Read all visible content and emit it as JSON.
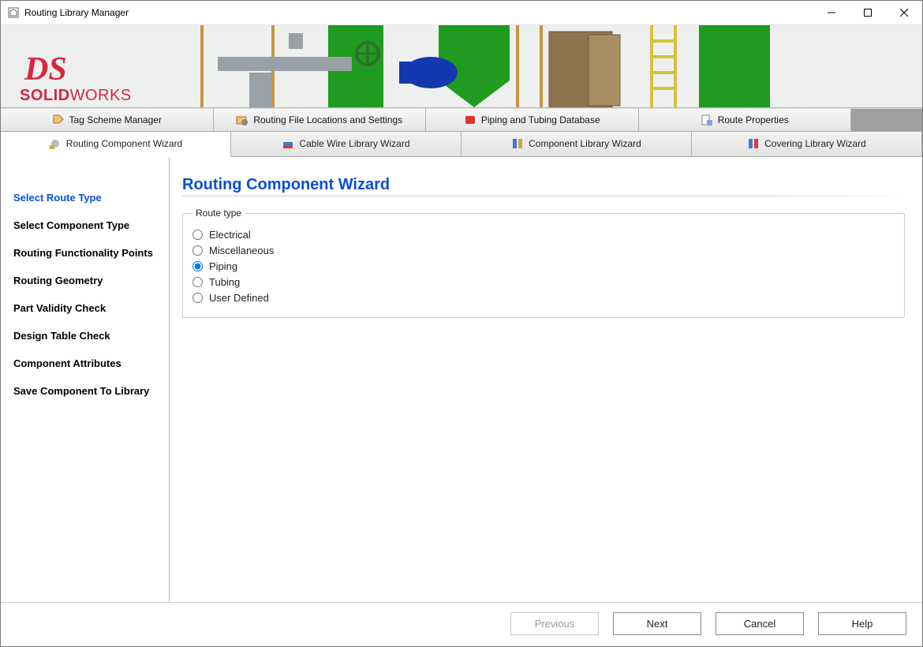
{
  "window": {
    "title": "Routing Library Manager"
  },
  "logo": {
    "ds": "DS",
    "brand_bold": "SOLID",
    "brand_thin": "WORKS"
  },
  "toolbar_tabs": {
    "tag_scheme": "Tag Scheme Manager",
    "file_loc": "Routing File Locations and Settings",
    "piping_db": "Piping and Tubing Database",
    "route_props": "Route Properties"
  },
  "wizard_tabs": {
    "component": "Routing Component Wizard",
    "cable": "Cable Wire Library Wizard",
    "complib": "Component Library Wizard",
    "covering": "Covering Library Wizard"
  },
  "sidebar_steps": [
    "Select Route Type",
    "Select Component Type",
    "Routing Functionality Points",
    "Routing Geometry",
    "Part Validity Check",
    "Design Table Check",
    "Component Attributes",
    "Save Component To Library"
  ],
  "main": {
    "heading": "Routing Component Wizard",
    "group_label": "Route type",
    "options": {
      "electrical": "Electrical",
      "misc": "Miscellaneous",
      "piping": "Piping",
      "tubing": "Tubing",
      "userdefined": "User Defined"
    },
    "selected": "piping"
  },
  "footer": {
    "previous": "Previous",
    "next": "Next",
    "cancel": "Cancel",
    "help": "Help"
  }
}
